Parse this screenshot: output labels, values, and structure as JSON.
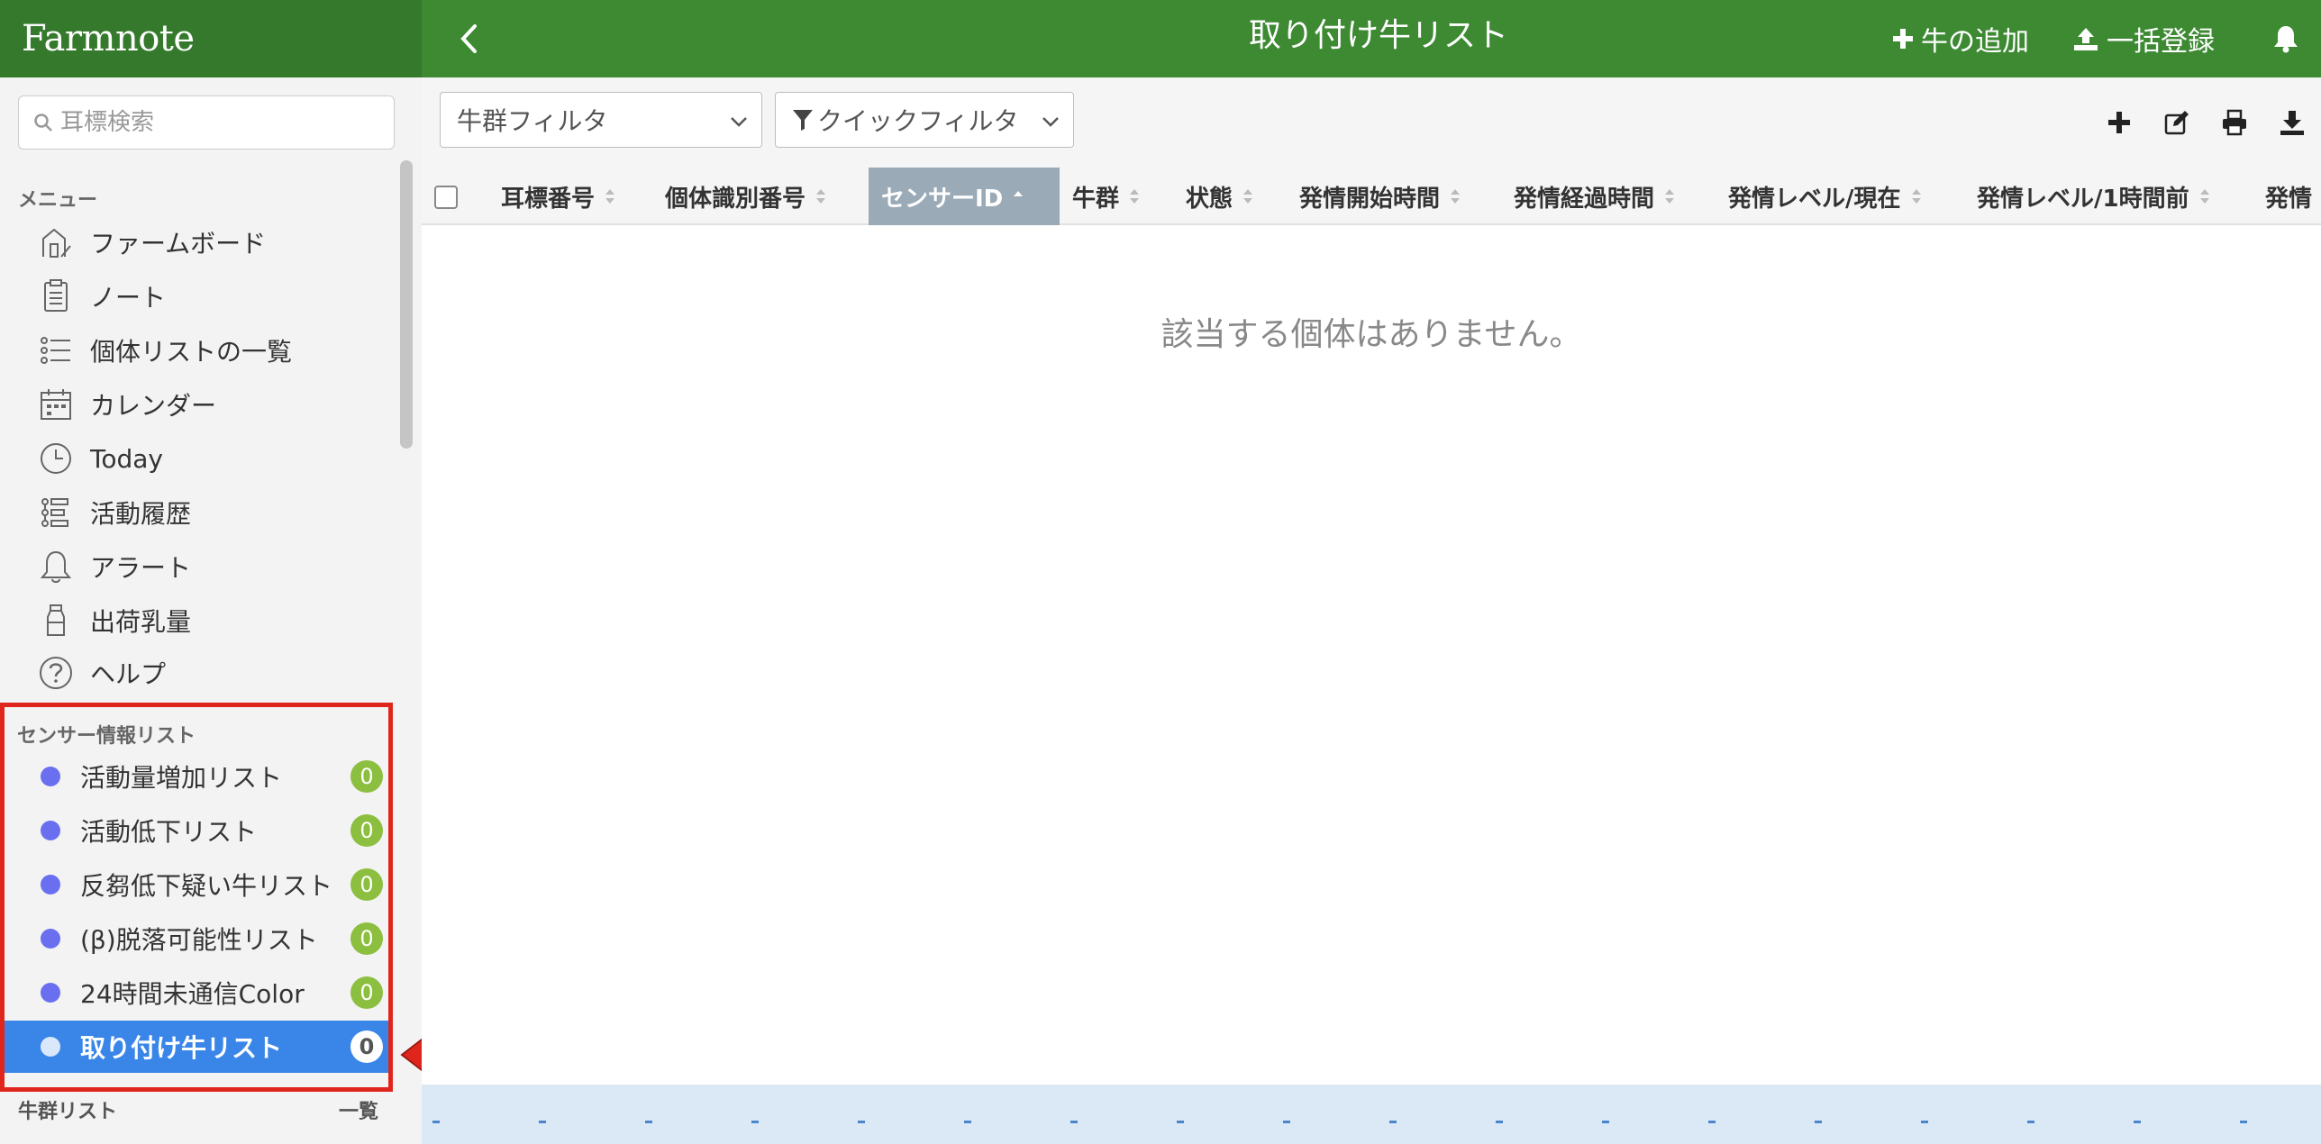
{
  "header": {
    "logo": "Farmnote",
    "title": "取り付け牛リスト",
    "add_cow_label": "牛の追加",
    "bulk_register_label": "一括登録"
  },
  "sidebar": {
    "search_placeholder": "耳標検索",
    "menu_heading": "メニュー",
    "menu_items": [
      {
        "label": "ファームボード",
        "icon": "farm-icon"
      },
      {
        "label": "ノート",
        "icon": "note-icon"
      },
      {
        "label": "個体リストの一覧",
        "icon": "list-icon"
      },
      {
        "label": "カレンダー",
        "icon": "calendar-icon"
      },
      {
        "label": "Today",
        "icon": "clock-icon"
      },
      {
        "label": "活動履歴",
        "icon": "history-icon"
      },
      {
        "label": "アラート",
        "icon": "bell-icon"
      },
      {
        "label": "出荷乳量",
        "icon": "milk-bottle-icon"
      },
      {
        "label": "ヘルプ",
        "icon": "help-icon"
      }
    ],
    "sensor_heading": "センサー情報リスト",
    "sensor_items": [
      {
        "label": "活動量増加リスト",
        "count": "0"
      },
      {
        "label": "活動低下リスト",
        "count": "0"
      },
      {
        "label": "反芻低下疑い牛リスト",
        "count": "0"
      },
      {
        "label": "(β)脱落可能性リスト",
        "count": "0"
      },
      {
        "label": "24時間未通信Color",
        "count": "0"
      },
      {
        "label": "取り付け牛リスト",
        "count": "0",
        "active": true
      }
    ],
    "herd_heading": "牛群リスト",
    "herd_all_label": "一覧"
  },
  "toolbar": {
    "herd_filter_label": "牛群フィルタ",
    "quick_filter_label": "クイックフィルタ"
  },
  "table": {
    "columns": [
      "耳標番号",
      "個体識別番号",
      "センサーID",
      "牛群",
      "状態",
      "発情開始時間",
      "発情経過時間",
      "発情レベル/現在",
      "発情レベル/1時間前",
      "発情"
    ],
    "sorted_column": "センサーID",
    "empty_message": "該当する個体はありません。"
  },
  "colors": {
    "header_green": "#3d8a33",
    "logo_green": "#357a2c",
    "active_blue": "#3a86e8",
    "badge_green": "#8cbf3f",
    "dot_purple": "#6a6ff0",
    "highlight_red": "#e0261c"
  }
}
